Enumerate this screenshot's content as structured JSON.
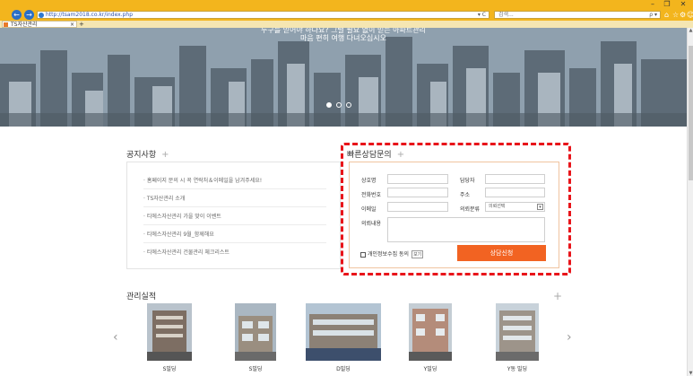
{
  "browser": {
    "url": "http://tsam2018.co.kr/index.php",
    "search_placeholder": "검색...",
    "tab_title": "TS자산관리",
    "win_min": "–",
    "win_max": "❐",
    "win_close": "✕",
    "back_icon": "←",
    "forward_icon": "→",
    "addr_controls": "▾ C",
    "search_glyph": "ρ ▾",
    "home_icon": "⌂",
    "star_icon": "☆",
    "gear_icon": "⚙",
    "smile_icon": "☺",
    "tab_close": "×",
    "new_tab": "+"
  },
  "hero": {
    "line1": "누구를 믿어야 하나요? 그럴 필요 없이 믿는 아파트관리",
    "line2": "마음 편히 여행 다녀오십시오"
  },
  "notice": {
    "title": "공지사항",
    "plus": "+",
    "items": [
      "· 홈페이지 문의 시 꼭 연락처＆이메일을 남겨주세요!",
      "· TS자산관리 소개",
      "· 티에스자산관리 가을 맞이 이벤트",
      "· 티에스자산관리 9월_함께해요",
      "· 티에스자산관리 건물관리 체크리스트"
    ]
  },
  "consult": {
    "title": "빠른상담문의",
    "plus": "+",
    "labels": {
      "company": "상호명",
      "manager": "담당자",
      "phone": "전화번호",
      "address": "주소",
      "email": "이메일",
      "category": "의뢰분류",
      "content": "의뢰내용"
    },
    "category_selected": "의뢰선택",
    "select_arrow": "▾",
    "privacy_label": "개인정보수집 동의",
    "privacy_view": "보기",
    "submit_label": "상담신청"
  },
  "portfolio": {
    "title": "관리실적",
    "plus": "+",
    "prev_icon": "‹",
    "next_icon": "›",
    "items": [
      "S빌딩",
      "S빌딩",
      "D빌딩",
      "Y빌딩",
      "Y동 빌딩"
    ]
  },
  "colors": {
    "chrome": "#f3b51d",
    "accent": "#f26322",
    "highlight": "#e8141a"
  }
}
